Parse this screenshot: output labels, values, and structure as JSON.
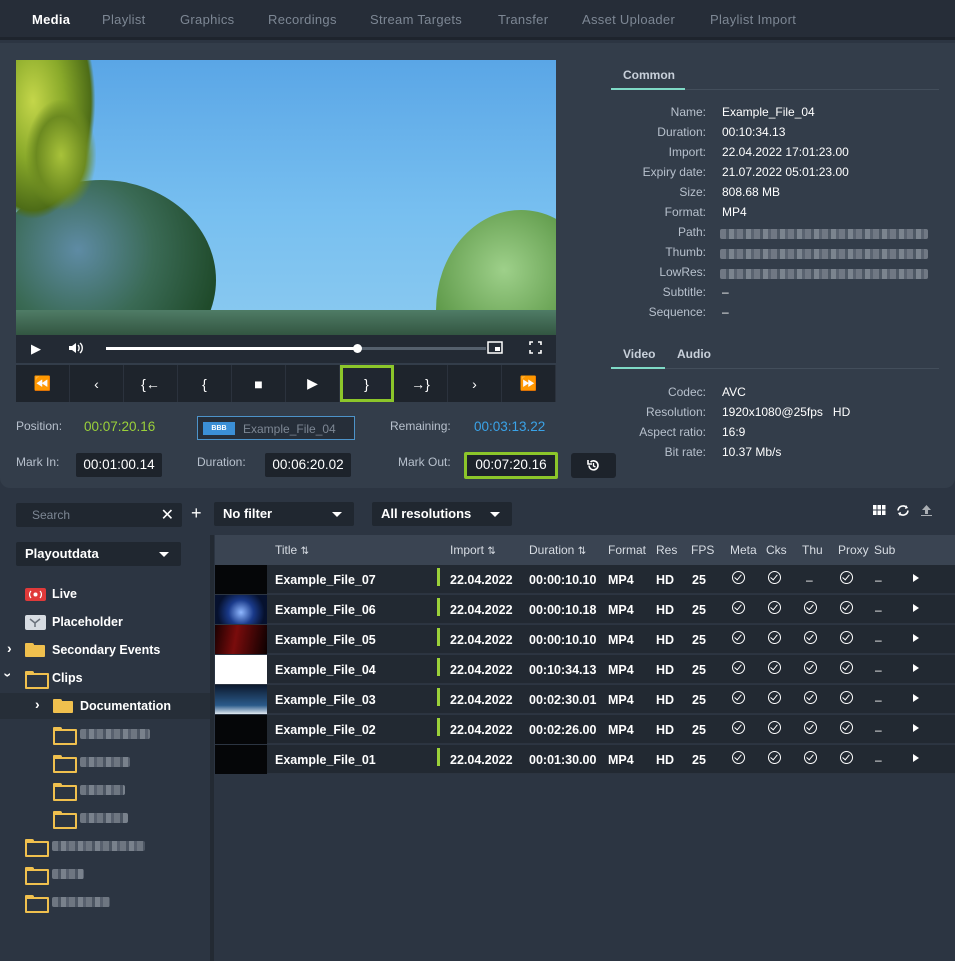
{
  "nav": {
    "tabs": [
      "Media",
      "Playlist",
      "Graphics",
      "Recordings",
      "Stream Targets",
      "Transfer",
      "Asset Uploader",
      "Playlist Import"
    ],
    "active": "Media"
  },
  "player": {
    "progress": 0.66,
    "transport": [
      "⏪",
      "‹",
      "{←",
      "{",
      "■",
      "▶",
      "}",
      "→}",
      "›",
      "⏩"
    ]
  },
  "timing": {
    "position_label": "Position:",
    "position": "00:07:20.16",
    "clip_name": "Example_File_04",
    "clip_thumb": "BBB",
    "remaining_label": "Remaining:",
    "remaining": "00:03:13.22",
    "markin_label": "Mark In:",
    "markin": "00:01:00.14",
    "duration_label": "Duration:",
    "duration": "00:06:20.02",
    "markout_label": "Mark Out:",
    "markout": "00:07:20.16"
  },
  "info": {
    "common_tab": "Common",
    "common": [
      {
        "label": "Name:",
        "value": "Example_File_04"
      },
      {
        "label": "Duration:",
        "value": "00:10:34.13"
      },
      {
        "label": "Import:",
        "value": "22.04.2022 17:01:23.00"
      },
      {
        "label": "Expiry date:",
        "value": "21.07.2022 05:01:23.00"
      },
      {
        "label": "Size:",
        "value": "808.68 MB"
      },
      {
        "label": "Format:",
        "value": "MP4"
      },
      {
        "label": "Path:",
        "value": ""
      },
      {
        "label": "Thumb:",
        "value": ""
      },
      {
        "label": "LowRes:",
        "value": ""
      },
      {
        "label": "Subtitle:",
        "value": "–"
      },
      {
        "label": "Sequence:",
        "value": "–"
      }
    ],
    "video_tab": "Video",
    "audio_tab": "Audio",
    "video": [
      {
        "label": "Codec:",
        "value": "AVC"
      },
      {
        "label": "Resolution:",
        "value": "1920x1080@25fps   HD"
      },
      {
        "label": "Aspect ratio:",
        "value": "16:9"
      },
      {
        "label": "Bit rate:",
        "value": "10.37 Mb/s"
      }
    ]
  },
  "toolbar": {
    "search_placeholder": "Search",
    "filter": "No filter",
    "resolutions": "All resolutions"
  },
  "tree": {
    "root": "Playoutdata",
    "items": [
      "Live",
      "Placeholder",
      "Secondary Events",
      "Clips",
      "Documentation"
    ]
  },
  "table": {
    "headers": [
      "Title",
      "Import",
      "Duration",
      "Format",
      "Res",
      "FPS",
      "Meta",
      "Cks",
      "Thu",
      "Proxy",
      "Sub"
    ],
    "rows": [
      {
        "title": "Example_File_07",
        "import": "22.04.2022",
        "duration": "00:00:10.10",
        "format": "MP4",
        "res": "HD",
        "fps": "25",
        "thu": "–",
        "sub": "–"
      },
      {
        "title": "Example_File_06",
        "import": "22.04.2022",
        "duration": "00:00:10.18",
        "format": "MP4",
        "res": "HD",
        "fps": "25",
        "thu": "",
        "sub": "–"
      },
      {
        "title": "Example_File_05",
        "import": "22.04.2022",
        "duration": "00:00:10.10",
        "format": "MP4",
        "res": "HD",
        "fps": "25",
        "thu": "",
        "sub": "–"
      },
      {
        "title": "Example_File_04",
        "import": "22.04.2022",
        "duration": "00:10:34.13",
        "format": "MP4",
        "res": "HD",
        "fps": "25",
        "thu": "",
        "sub": "–"
      },
      {
        "title": "Example_File_03",
        "import": "22.04.2022",
        "duration": "00:02:30.01",
        "format": "MP4",
        "res": "HD",
        "fps": "25",
        "thu": "",
        "sub": "–"
      },
      {
        "title": "Example_File_02",
        "import": "22.04.2022",
        "duration": "00:02:26.00",
        "format": "MP4",
        "res": "HD",
        "fps": "25",
        "thu": "",
        "sub": "–"
      },
      {
        "title": "Example_File_01",
        "import": "22.04.2022",
        "duration": "00:01:30.00",
        "format": "MP4",
        "res": "HD",
        "fps": "25",
        "thu": "",
        "sub": "–"
      }
    ]
  }
}
